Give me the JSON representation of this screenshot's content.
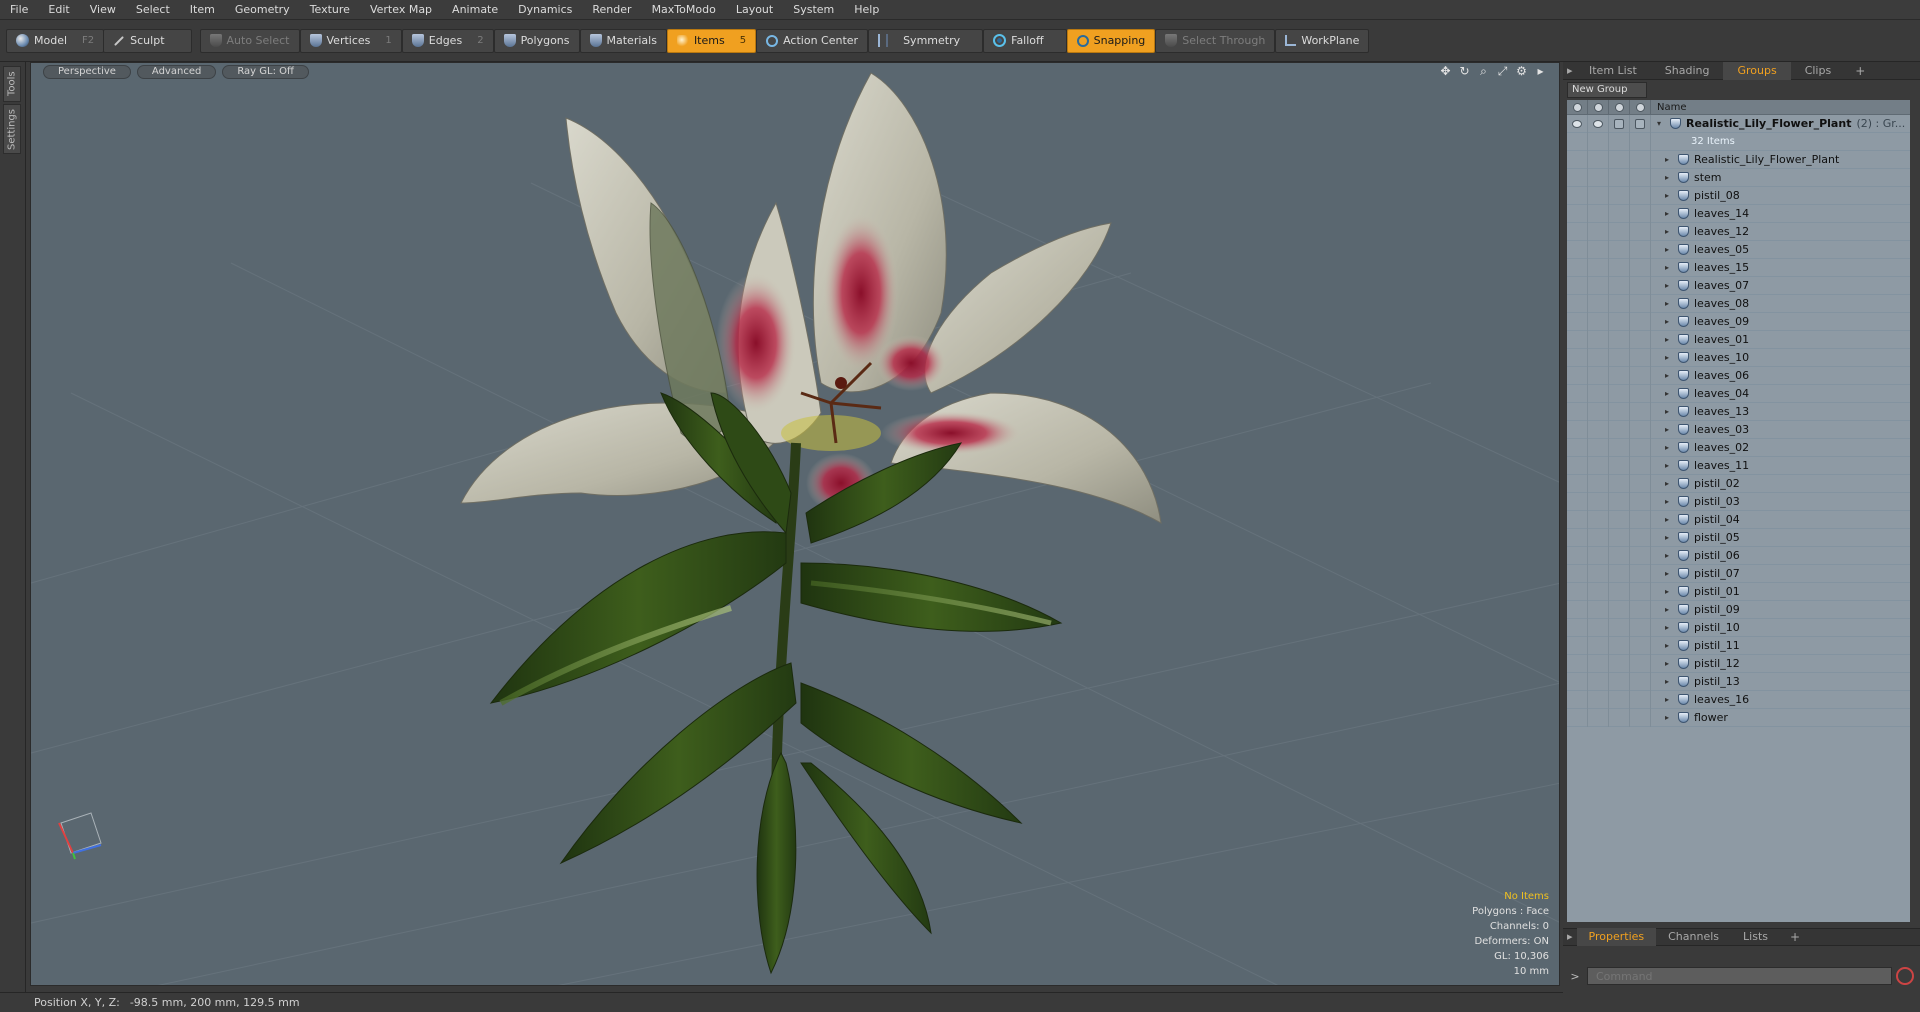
{
  "menu": [
    "File",
    "Edit",
    "View",
    "Select",
    "Item",
    "Geometry",
    "Texture",
    "Vertex Map",
    "Animate",
    "Dynamics",
    "Render",
    "MaxToModo",
    "Layout",
    "System",
    "Help"
  ],
  "toolbar": {
    "model": "Model",
    "model_hotkey": "F2",
    "sculpt": "Sculpt",
    "auto_select": "Auto Select",
    "vertices": "Vertices",
    "vertices_hotkey": "1",
    "edges": "Edges",
    "edges_hotkey": "2",
    "polygons": "Polygons",
    "materials": "Materials",
    "items": "Items",
    "items_hotkey": "5",
    "action_center": "Action Center",
    "symmetry": "Symmetry",
    "falloff": "Falloff",
    "snapping": "Snapping",
    "select_through": "Select Through",
    "workplane": "WorkPlane"
  },
  "left_tabs": [
    "Tools",
    "Settings"
  ],
  "viewport": {
    "view": "Perspective",
    "shading": "Advanced",
    "raygl": "Ray GL: Off",
    "info": {
      "selection": "No Items",
      "polygons": "Polygons : Face",
      "channels": "Channels: 0",
      "deformers": "Deformers: ON",
      "gl": "GL: 10,306",
      "grid": "10 mm"
    }
  },
  "right_panel": {
    "tabs": [
      "Item List",
      "Shading",
      "Groups",
      "Clips"
    ],
    "active_tab": "Groups",
    "new_group": "New Group",
    "column_name": "Name",
    "root": {
      "name": "Realistic_Lily_Flower_Plant",
      "suffix": "(2) : Gr...",
      "count": "32 Items"
    },
    "items": [
      "Realistic_Lily_Flower_Plant",
      "stem",
      "pistil_08",
      "leaves_14",
      "leaves_12",
      "leaves_05",
      "leaves_15",
      "leaves_07",
      "leaves_08",
      "leaves_09",
      "leaves_01",
      "leaves_10",
      "leaves_06",
      "leaves_04",
      "leaves_13",
      "leaves_03",
      "leaves_02",
      "leaves_11",
      "pistil_02",
      "pistil_03",
      "pistil_04",
      "pistil_05",
      "pistil_06",
      "pistil_07",
      "pistil_01",
      "pistil_09",
      "pistil_10",
      "pistil_11",
      "pistil_12",
      "pistil_13",
      "leaves_16",
      "flower"
    ],
    "bottom_tabs": [
      "Properties",
      "Channels",
      "Lists"
    ],
    "bottom_active": "Properties",
    "command_placeholder": "Command"
  },
  "status": {
    "label": "Position X, Y, Z:",
    "value": "-98.5 mm, 200 mm, 129.5 mm"
  },
  "colors": {
    "accent": "#f0a020",
    "viewport_bg": "#5a6770",
    "group_bg": "#8e9aa4"
  }
}
